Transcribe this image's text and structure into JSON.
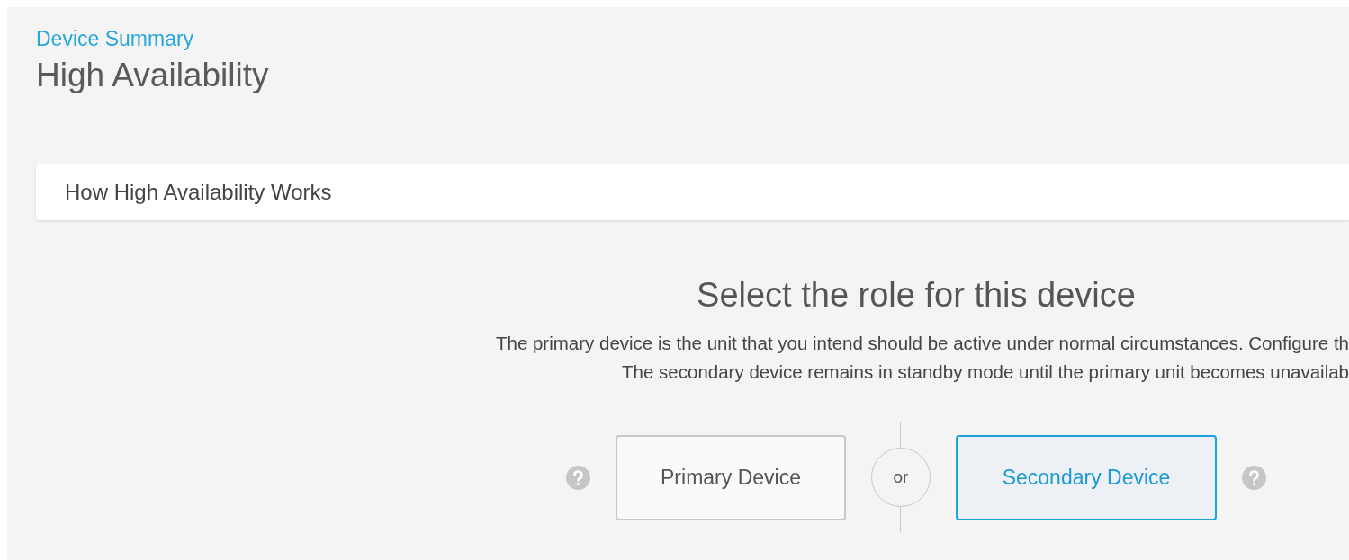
{
  "breadcrumb": "Device Summary",
  "title": "High Availability",
  "info_panel": {
    "title": "How High Availability Works",
    "expanded": false
  },
  "role_selection": {
    "heading": "Select the role for this device",
    "description": [
      "The primary device is the unit that you intend should be active under normal circumstances. Configure th",
      "The secondary device remains in standby mode until the primary unit becomes unavailab"
    ],
    "separator": "or",
    "roles": [
      {
        "label": "Primary Device",
        "selected": false
      },
      {
        "label": "Secondary Device",
        "selected": true
      }
    ]
  }
}
